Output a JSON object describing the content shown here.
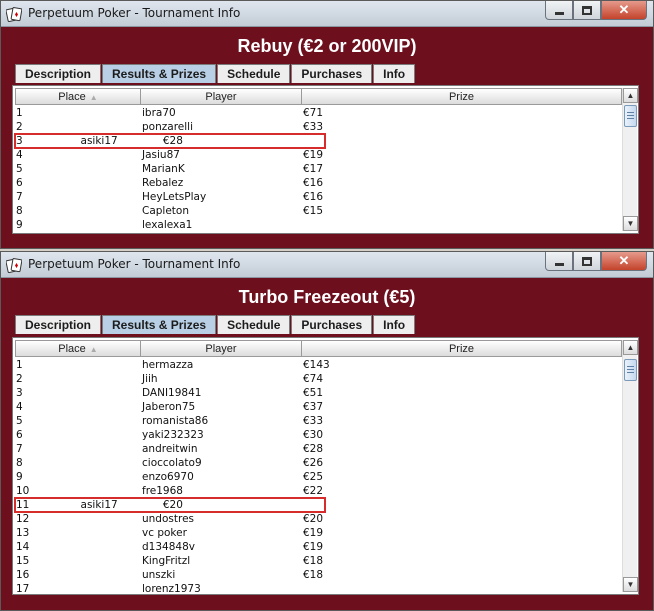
{
  "windows": [
    {
      "title": "Perpetuum Poker - Tournament Info",
      "heading": "Rebuy (€2 or 200VIP)",
      "tabs": [
        "Description",
        "Results & Prizes",
        "Schedule",
        "Purchases",
        "Info"
      ],
      "active_tab": "Results & Prizes",
      "columns": [
        "Place",
        "Player",
        "Prize"
      ],
      "rows": [
        {
          "place": "1",
          "player": "ibra70",
          "prize": "€71"
        },
        {
          "place": "2",
          "player": "ponzarelli",
          "prize": "€33"
        },
        {
          "place": "3",
          "player": "asiki17",
          "prize": "€28",
          "highlighted": true
        },
        {
          "place": "4",
          "player": "Jasiu87",
          "prize": "€19"
        },
        {
          "place": "5",
          "player": "MarianK",
          "prize": "€17"
        },
        {
          "place": "6",
          "player": "Rebalez",
          "prize": "€16"
        },
        {
          "place": "7",
          "player": "HeyLetsPlay",
          "prize": "€16"
        },
        {
          "place": "8",
          "player": "Capleton",
          "prize": "€15"
        },
        {
          "place": "9",
          "player": "lexalexa1",
          "prize": ""
        }
      ]
    },
    {
      "title": "Perpetuum Poker - Tournament Info",
      "heading": "Turbo Freezeout (€5)",
      "tabs": [
        "Description",
        "Results & Prizes",
        "Schedule",
        "Purchases",
        "Info"
      ],
      "active_tab": "Results & Prizes",
      "columns": [
        "Place",
        "Player",
        "Prize"
      ],
      "rows": [
        {
          "place": "1",
          "player": "hermazza",
          "prize": "€143"
        },
        {
          "place": "2",
          "player": "Jiih",
          "prize": "€74"
        },
        {
          "place": "3",
          "player": "DANI19841",
          "prize": "€51"
        },
        {
          "place": "4",
          "player": "Jaberon75",
          "prize": "€37"
        },
        {
          "place": "5",
          "player": "romanista86",
          "prize": "€33"
        },
        {
          "place": "6",
          "player": "yaki232323",
          "prize": "€30"
        },
        {
          "place": "7",
          "player": "andreitwin",
          "prize": "€28"
        },
        {
          "place": "8",
          "player": "cioccolato9",
          "prize": "€26"
        },
        {
          "place": "9",
          "player": "enzo6970",
          "prize": "€25"
        },
        {
          "place": "10",
          "player": "fre1968",
          "prize": "€22"
        },
        {
          "place": "11",
          "player": "asiki17",
          "prize": "€20",
          "highlighted": true
        },
        {
          "place": "12",
          "player": "undostres",
          "prize": "€20"
        },
        {
          "place": "13",
          "player": "vc poker",
          "prize": "€19"
        },
        {
          "place": "14",
          "player": "d134848v",
          "prize": "€19"
        },
        {
          "place": "15",
          "player": "KingFritzl",
          "prize": "€18"
        },
        {
          "place": "16",
          "player": "unszki",
          "prize": "€18"
        },
        {
          "place": "17",
          "player": "lorenz1973",
          "prize": ""
        }
      ]
    }
  ],
  "icons": {
    "app": "poker-cards-icon",
    "minimize": "minimize-icon",
    "maximize": "maximize-icon",
    "close": "close-icon",
    "sort": "sort-ascending-icon",
    "scroll_up": "scroll-up-arrow-icon",
    "scroll_down": "scroll-down-arrow-icon"
  },
  "colors": {
    "window_bg": "#6d0f1c",
    "highlight_border": "#d62c2c",
    "active_tab": "#b8cfe5"
  }
}
